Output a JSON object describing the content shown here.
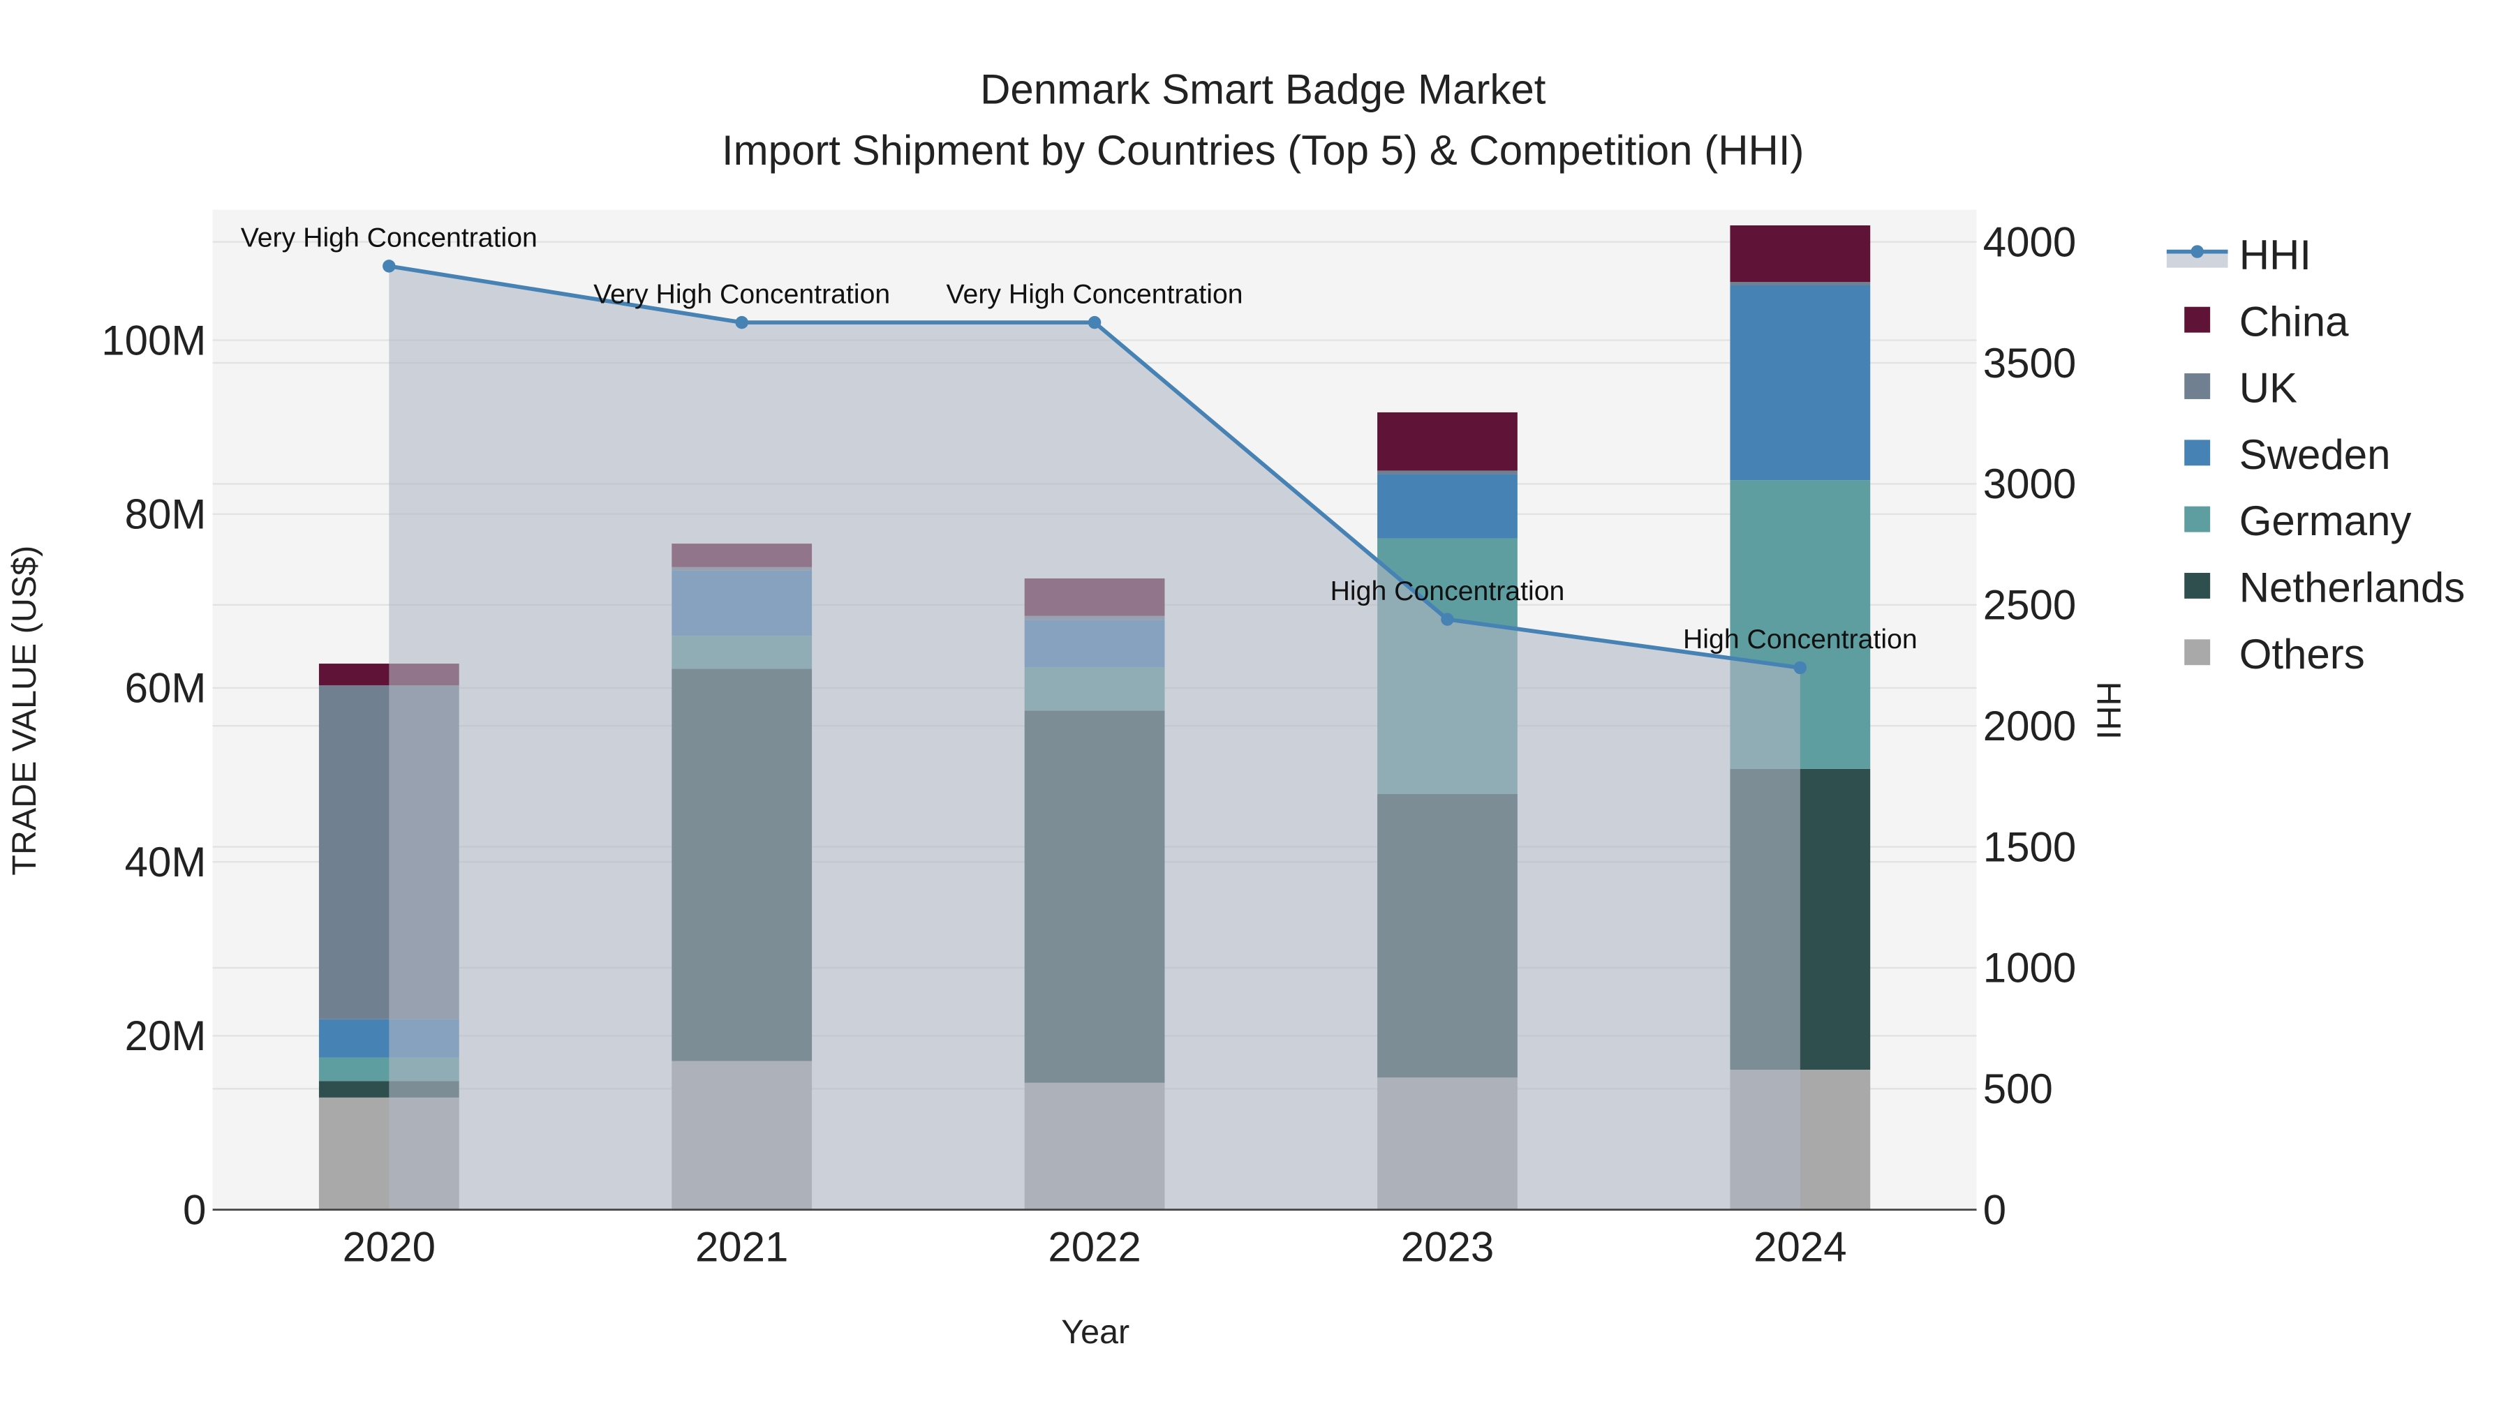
{
  "chart_data": {
    "type": "bar",
    "stacked": true,
    "title": "Denmark Smart Badge Market",
    "subtitle": "Import Shipment by Countries (Top 5) & Competition (HHI)",
    "xlabel": "Year",
    "ylabel": "TRADE VALUE (US$)",
    "y2label": "HHI",
    "categories": [
      "2020",
      "2021",
      "2022",
      "2023",
      "2024"
    ],
    "ylim": [
      0,
      115000000
    ],
    "y2lim": [
      0,
      4133
    ],
    "yticks": [
      0,
      20000000,
      40000000,
      60000000,
      80000000,
      100000000
    ],
    "ytick_labels": [
      "0",
      "20M",
      "40M",
      "60M",
      "80M",
      "100M"
    ],
    "y2ticks": [
      0,
      500,
      1000,
      1500,
      2000,
      2500,
      3000,
      3500,
      4000
    ],
    "y2tick_labels": [
      "0",
      "500",
      "1000",
      "1500",
      "2000",
      "2500",
      "3000",
      "3500",
      "4000"
    ],
    "grid": true,
    "legend_placement": "right",
    "series": [
      {
        "name": "Others",
        "color": "#a9a9a9",
        "values": [
          12900000,
          17100000,
          14600000,
          15200000,
          16100000
        ]
      },
      {
        "name": "Netherlands",
        "color": "#2f4f4f",
        "values": [
          1900000,
          45100000,
          42800000,
          32600000,
          34600000
        ]
      },
      {
        "name": "Germany",
        "color": "#5f9ea0",
        "values": [
          2700000,
          3800000,
          5000000,
          29400000,
          33200000
        ]
      },
      {
        "name": "Sweden",
        "color": "#4682b4",
        "values": [
          4400000,
          7500000,
          5400000,
          7400000,
          22400000
        ]
      },
      {
        "name": "UK",
        "color": "#708090",
        "values": [
          38400000,
          400000,
          500000,
          400000,
          400000
        ]
      },
      {
        "name": "China",
        "color": "#5f1336",
        "values": [
          2500000,
          2700000,
          4300000,
          6700000,
          6500000
        ]
      }
    ],
    "hhi": {
      "name": "HHI",
      "color": "#4682b4",
      "values": [
        3900,
        3667,
        3667,
        2440,
        2240
      ],
      "annotations": [
        "Very High Concentration",
        "Very High Concentration",
        "Very High Concentration",
        "High Concentration",
        "High Concentration"
      ]
    },
    "legend": [
      "HHI",
      "China",
      "UK",
      "Sweden",
      "Germany",
      "Netherlands",
      "Others"
    ]
  }
}
